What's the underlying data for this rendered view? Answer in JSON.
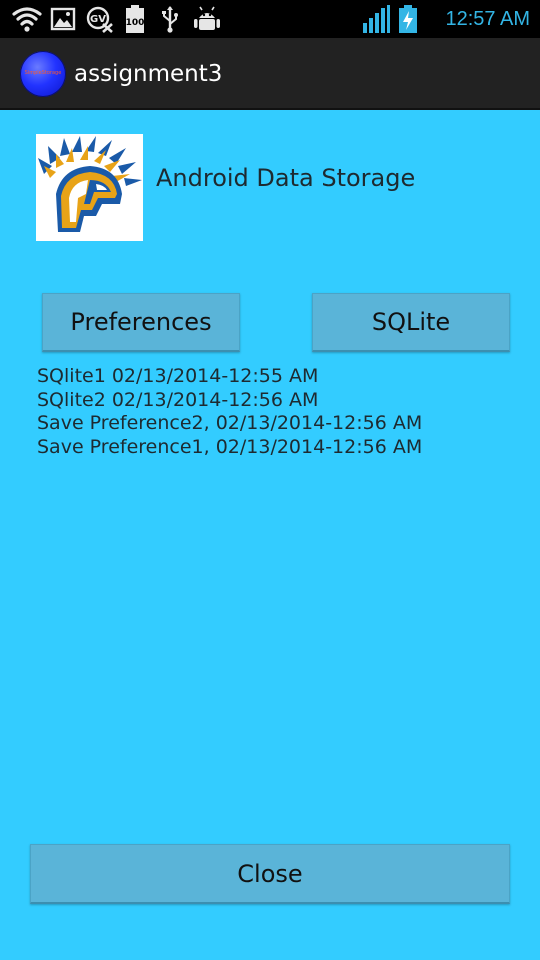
{
  "status_bar": {
    "time": "12:57 AM",
    "icons": [
      "wifi-icon",
      "gallery-icon",
      "google-voice-icon",
      "battery-100-icon",
      "usb-icon",
      "android-debug-icon",
      "signal-icon",
      "charging-battery-icon"
    ],
    "battery_label": "100",
    "accent_color": "#33b5e5"
  },
  "action_bar": {
    "title": "assignment3",
    "app_icon_text": "SimpleStorage"
  },
  "header": {
    "title": "Android Data Storage",
    "logo_icon": "spartan-logo-icon"
  },
  "buttons": {
    "preferences": "Preferences",
    "sqlite": "SQLite",
    "close": "Close"
  },
  "log": {
    "items": [
      "SQlite1 02/13/2014-12:55 AM",
      "SQlite2 02/13/2014-12:56 AM",
      "Save Preference2, 02/13/2014-12:56 AM",
      "Save Preference1, 02/13/2014-12:56 AM"
    ]
  },
  "colors": {
    "background": "#33ccff",
    "button": "#5ab4d8",
    "action_bar": "#222222"
  }
}
